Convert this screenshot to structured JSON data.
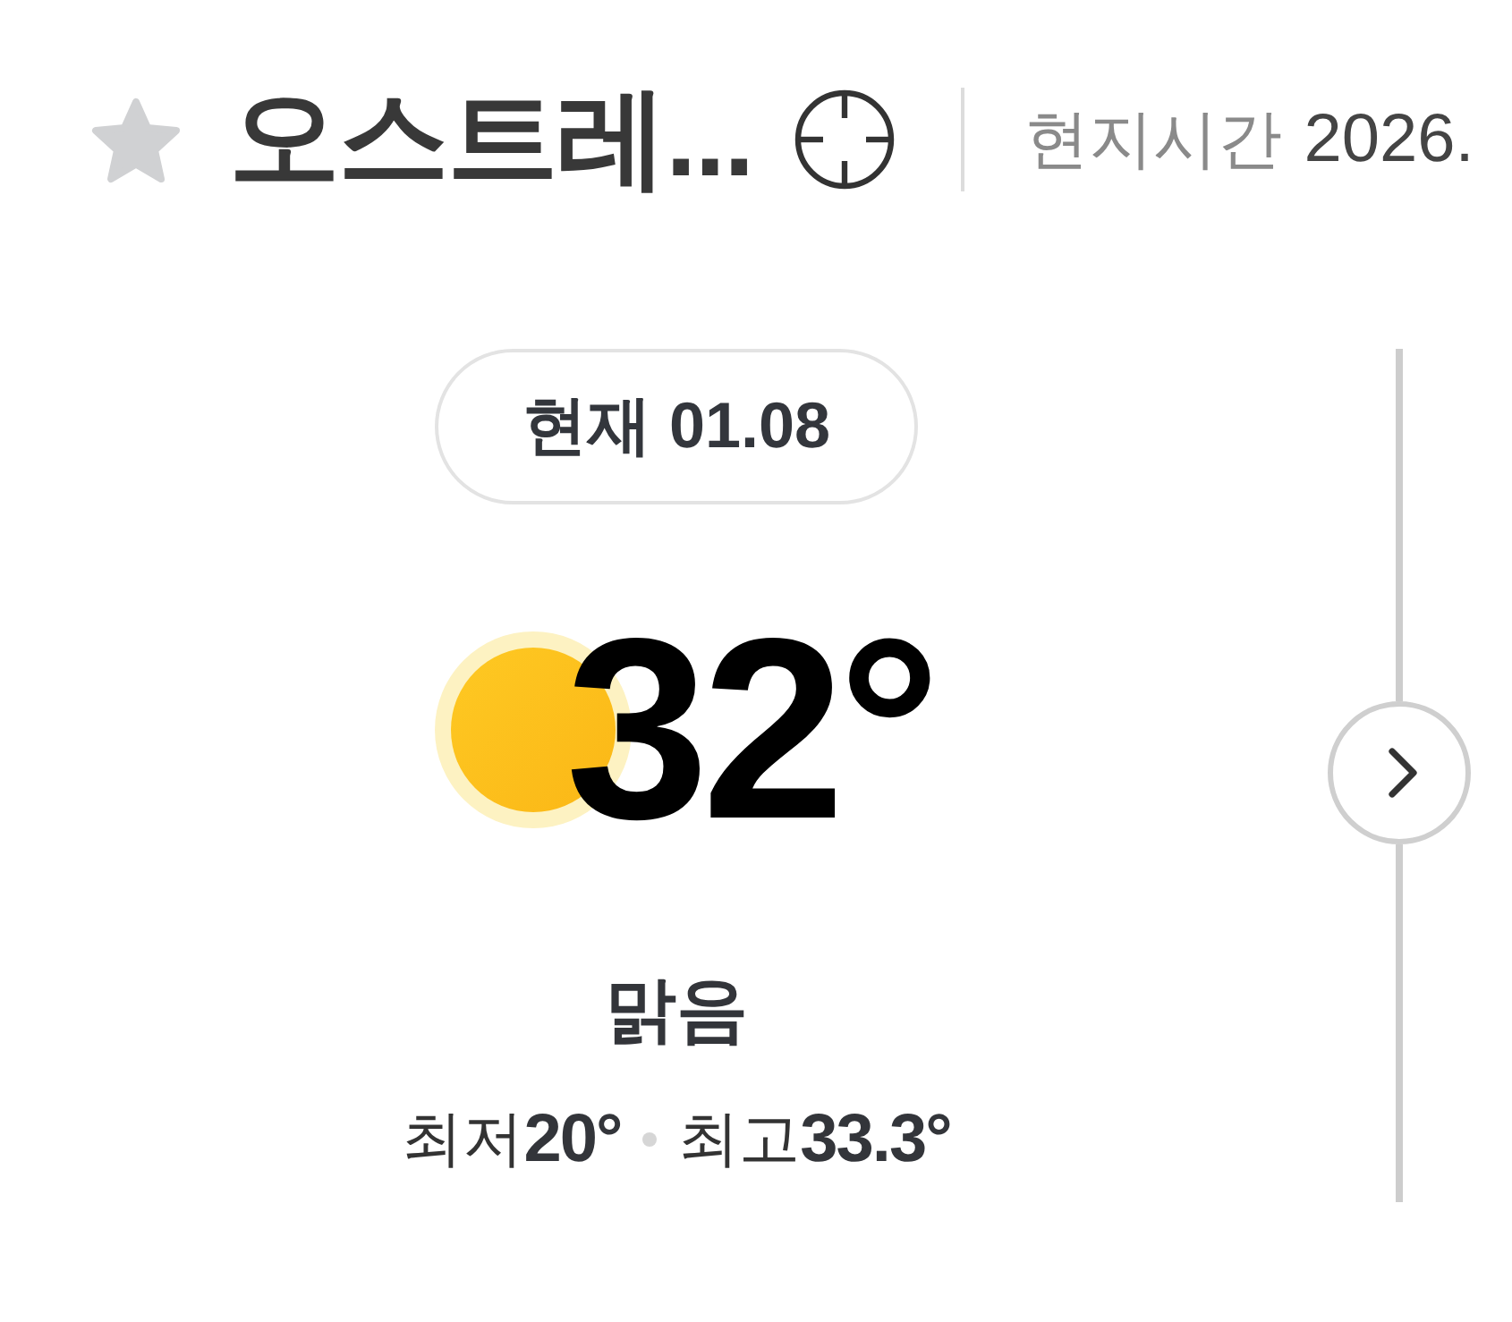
{
  "header": {
    "favorite": {
      "on": false
    },
    "title": "오스트레...",
    "local_time_label": "현지시간",
    "local_time_value": "2026."
  },
  "current": {
    "date_label": "현재 01.08",
    "temperature": "32°",
    "condition": "맑음",
    "low_label": "최저",
    "low": "20°",
    "high_label": "최고",
    "high": "33.3°"
  }
}
